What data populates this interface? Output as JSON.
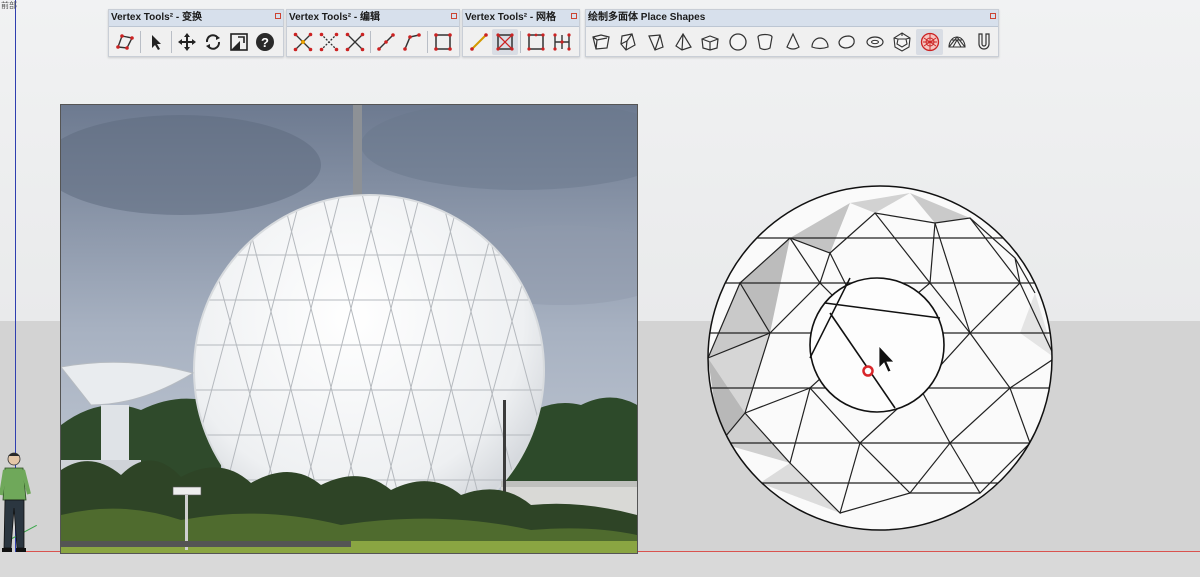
{
  "viewport": {
    "corner_label": "前部",
    "colors": {
      "sky": "#eeeff0",
      "ground": "#d3d3d3",
      "axis_red": "#d9534f",
      "axis_blue": "#2f3fb0",
      "axis_green": "#3aa64a"
    }
  },
  "toolbars": [
    {
      "title": "Vertex Tools² - 变换",
      "icons": [
        "select-vertex-icon",
        "pointer-icon",
        "move-icon",
        "rotate-icon",
        "scale-icon",
        "help-icon"
      ]
    },
    {
      "title": "Vertex Tools² - 编辑",
      "icons": [
        "merge-vertices-icon",
        "weld-vertices-icon",
        "split-vertices-icon",
        "connect-edge-icon",
        "bevel-edge-icon",
        "quad-edge-icon"
      ]
    },
    {
      "title": "Vertex Tools² - 网格",
      "icons": [
        "draw-line-icon",
        "grid-subdivide-icon",
        "mesh-quad-icon",
        "mesh-grid-icon"
      ]
    },
    {
      "title": "绘制多面体 Place Shapes",
      "icons": [
        "box-shape-icon",
        "prism-shape-icon",
        "wedge-shape-icon",
        "tetrahedron-shape-icon",
        "cylinder-shape-icon",
        "circle-shape-icon",
        "tube-shape-icon",
        "cone-shape-icon",
        "half-sphere-shape-icon",
        "lens-shape-icon",
        "torus-shape-icon",
        "dodecahedron-shape-icon",
        "geodesic-sphere-shape-icon",
        "dome-shape-icon",
        "u-shape-icon"
      ]
    }
  ],
  "active_shape": "geodesic-sphere-shape-icon",
  "reference_image": {
    "subject": "geodesic-radome-photo"
  },
  "model": {
    "subject": "geodesic-sphere-model",
    "cursor": "pointer-cursor",
    "inference_point_color": "#d8262a"
  }
}
